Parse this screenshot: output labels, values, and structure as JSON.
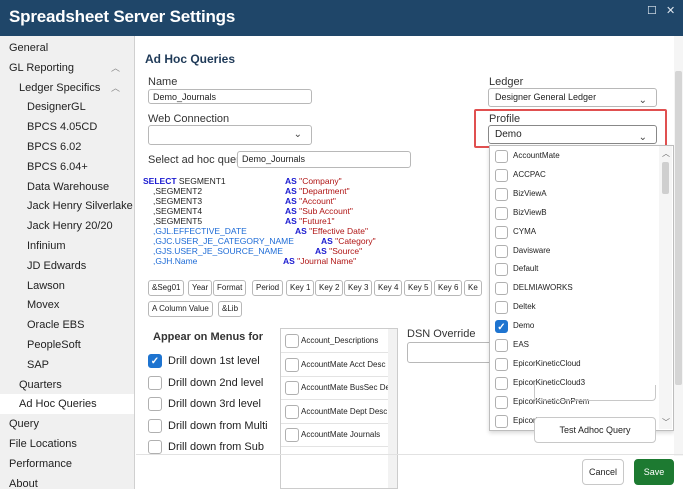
{
  "window": {
    "title": "Spreadsheet Server Settings"
  },
  "sidebar": {
    "items": [
      {
        "label": "General"
      },
      {
        "label": "GL Reporting"
      },
      {
        "label": "Ledger Specifics"
      },
      {
        "label": "DesignerGL"
      },
      {
        "label": "BPCS 4.05CD"
      },
      {
        "label": "BPCS 6.02"
      },
      {
        "label": "BPCS 6.04+"
      },
      {
        "label": "Data Warehouse"
      },
      {
        "label": "Jack Henry Silverlake"
      },
      {
        "label": "Jack Henry 20/20"
      },
      {
        "label": "Infinium"
      },
      {
        "label": "JD Edwards"
      },
      {
        "label": "Lawson"
      },
      {
        "label": "Movex"
      },
      {
        "label": "Oracle EBS"
      },
      {
        "label": "PeopleSoft"
      },
      {
        "label": "SAP"
      },
      {
        "label": "Quarters"
      },
      {
        "label": "Ad Hoc Queries"
      },
      {
        "label": "Query"
      },
      {
        "label": "File Locations"
      },
      {
        "label": "Performance"
      },
      {
        "label": "About"
      }
    ],
    "selected": "Ad Hoc Queries"
  },
  "main": {
    "heading": "Ad Hoc Queries",
    "name_label": "Name",
    "name_value": "Demo_Journals",
    "web_connection_label": "Web Connection",
    "web_connection_value": "",
    "select_query_label": "Select ad hoc query",
    "select_query_value": "Demo_Journals",
    "ledger_label": "Ledger",
    "ledger_value": "Designer General Ledger",
    "profile_label": "Profile",
    "profile_value": "Demo",
    "sql_lines": [
      {
        "l": "SELECT SEGMENT1",
        "r": "AS \"Company\""
      },
      {
        "l": ",SEGMENT2",
        "r": "AS \"Department\""
      },
      {
        "l": ",SEGMENT3",
        "r": "AS \"Account\""
      },
      {
        "l": ",SEGMENT4",
        "r": "AS \"Sub Account\""
      },
      {
        "l": ",SEGMENT5",
        "r": "AS \"Future1\""
      },
      {
        "l": ",GJL.EFFECTIVE_DATE",
        "r": "AS \"Effective Date\""
      },
      {
        "l": ",GJC.USER_JE_CATEGORY_NAME",
        "r": "AS \"Category\""
      },
      {
        "l": ",GJS.USER_JE_SOURCE_NAME",
        "r": "AS \"Source\""
      },
      {
        "l": ",GJH.Name",
        "r": "AS \"Journal Name\""
      }
    ],
    "tokens": [
      "&Seg01",
      "Year",
      "Format",
      "Period",
      "Key 1",
      "Key 2",
      "Key 3",
      "Key 4",
      "Key 5",
      "Key 6",
      "Ke"
    ],
    "tokens2": [
      "A Column Value",
      "&Lib"
    ],
    "appear_label": "Appear on Menus for",
    "menu_options": [
      {
        "label": "Drill down 1st level",
        "checked": true
      },
      {
        "label": "Drill down 2nd level",
        "checked": false
      },
      {
        "label": "Drill down 3rd level",
        "checked": false
      },
      {
        "label": "Drill down from Multi",
        "checked": false
      },
      {
        "label": "Drill down from Sub",
        "checked": false
      }
    ],
    "accounts": [
      "Account_Descriptions",
      "AccountMate Acct Desc",
      "AccountMate BusSec De",
      "AccountMate Dept Desc",
      "AccountMate Journals"
    ],
    "dsn_label": "DSN Override",
    "dsn_value": "",
    "profile_options": [
      {
        "label": "AccountMate",
        "checked": false
      },
      {
        "label": "ACCPAC",
        "checked": false
      },
      {
        "label": "BizViewA",
        "checked": false
      },
      {
        "label": "BizViewB",
        "checked": false
      },
      {
        "label": "CYMA",
        "checked": false
      },
      {
        "label": "Davisware",
        "checked": false
      },
      {
        "label": "Default",
        "checked": false
      },
      {
        "label": "DELMIAWORKS",
        "checked": false
      },
      {
        "label": "Deltek",
        "checked": false
      },
      {
        "label": "Demo",
        "checked": true
      },
      {
        "label": "EAS",
        "checked": false
      },
      {
        "label": "EpicorKineticCloud",
        "checked": false
      },
      {
        "label": "EpicorKineticCloud3",
        "checked": false
      },
      {
        "label": "EpicorKineticOnPrem",
        "checked": false
      },
      {
        "label": "EpicorKineticOnPremUnposted",
        "checked": false
      }
    ],
    "test_button": "Test Adhoc Query",
    "cancel_button": "Cancel",
    "save_button": "Save"
  },
  "colors": {
    "titlebar": "#1f4669",
    "accent": "#1e74d0",
    "highlight_border": "#e05050",
    "save": "#1d7a31"
  }
}
